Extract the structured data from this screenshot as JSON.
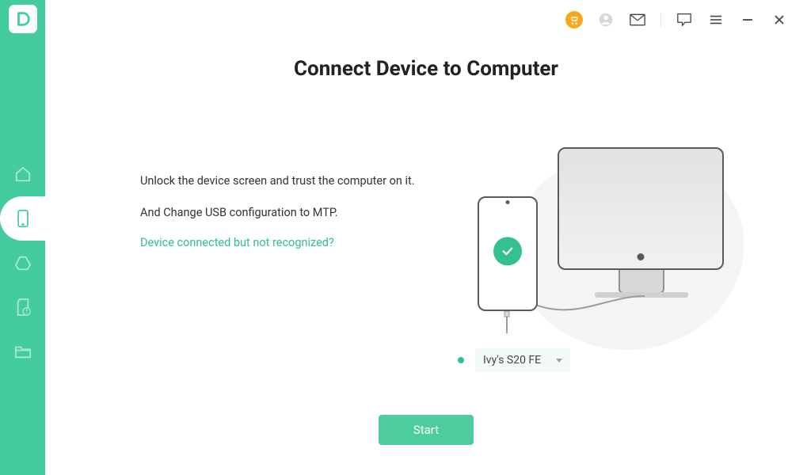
{
  "app": {
    "logo_letter": "D"
  },
  "titlebar": {
    "icons": [
      "cart",
      "user",
      "mail",
      "feedback",
      "menu",
      "minimize",
      "close"
    ]
  },
  "page": {
    "title": "Connect Device to Computer",
    "instruction1": "Unlock the device screen and trust the computer on it.",
    "instruction2": "And Change USB configuration to MTP.",
    "help_link": "Device connected but not recognized?"
  },
  "device": {
    "selected": "Ivy's S20 FE"
  },
  "actions": {
    "start": "Start"
  },
  "sidebar": {
    "items": [
      "home",
      "device",
      "cloud",
      "sd-alert",
      "folder"
    ],
    "active_index": 1
  }
}
